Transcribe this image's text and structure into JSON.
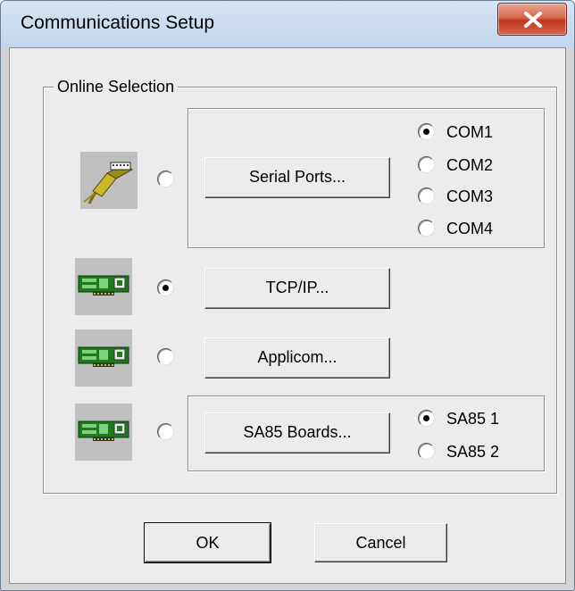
{
  "window": {
    "title": "Communications Setup",
    "close_icon": "close-x-icon"
  },
  "online_selection": {
    "label": "Online Selection",
    "serial": {
      "icon": "serial-cable-icon",
      "selected": false,
      "button_label": "Serial Ports...",
      "ports": [
        {
          "label": "COM1",
          "selected": true
        },
        {
          "label": "COM2",
          "selected": false
        },
        {
          "label": "COM3",
          "selected": false
        },
        {
          "label": "COM4",
          "selected": false
        }
      ]
    },
    "tcpip": {
      "icon": "network-card-icon",
      "selected": true,
      "button_label": "TCP/IP..."
    },
    "applicom": {
      "icon": "network-card-icon",
      "selected": false,
      "button_label": "Applicom..."
    },
    "sa85": {
      "icon": "network-card-icon",
      "selected": false,
      "button_label": "SA85 Boards...",
      "boards": [
        {
          "label": "SA85 1",
          "selected": true
        },
        {
          "label": "SA85 2",
          "selected": false
        }
      ]
    }
  },
  "buttons": {
    "ok": "OK",
    "cancel": "Cancel"
  },
  "colors": {
    "title_bar": "#c8dcf2",
    "close_button": "#c94a35",
    "dialog_background": "#ececec",
    "card_green": "#2a8a2a"
  }
}
